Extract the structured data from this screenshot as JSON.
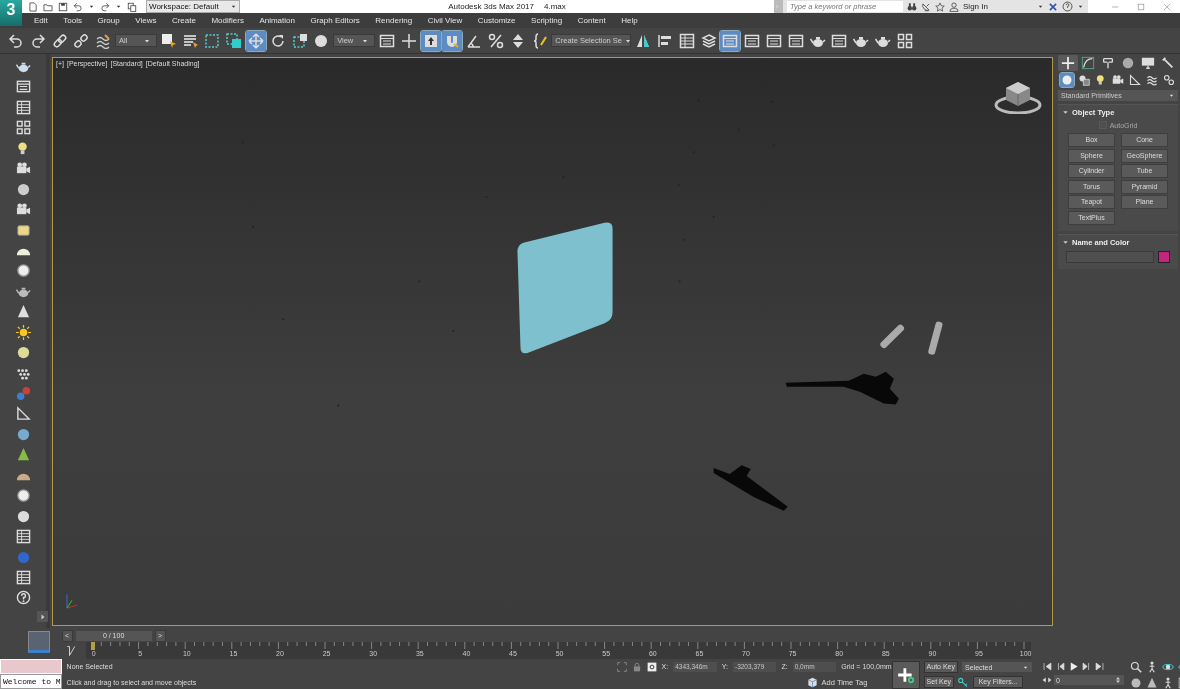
{
  "title_bar": {
    "logo": "3",
    "workspace": "Workspace: Default",
    "app_title": "Autodesk 3ds Max 2017",
    "file_name": "4.max",
    "search": {
      "placeholder": "Type a keyword or phrase"
    },
    "sign_in": "Sign In"
  },
  "menu": [
    "Edit",
    "Tools",
    "Group",
    "Views",
    "Create",
    "Modifiers",
    "Animation",
    "Graph Editors",
    "Rendering",
    "Civil View",
    "Customize",
    "Scripting",
    "Content",
    "Help"
  ],
  "main_toolbar": [
    {
      "kind": "tool",
      "selected": false
    },
    {
      "kind": "tool",
      "selected": false
    },
    {
      "kind": "tool",
      "selected": false
    },
    {
      "kind": "tool",
      "selected": false
    },
    {
      "kind": "tool",
      "selected": false
    },
    {
      "kind": "dropdown",
      "value": "All"
    },
    {
      "kind": "tool",
      "selected": false
    },
    {
      "kind": "tool",
      "selected": false
    },
    {
      "kind": "tool",
      "selected": false
    },
    {
      "kind": "tool",
      "selected": false
    },
    {
      "kind": "tool",
      "selected": true
    },
    {
      "kind": "tool",
      "selected": false
    },
    {
      "kind": "tool",
      "selected": false
    },
    {
      "kind": "tool",
      "selected": false
    },
    {
      "kind": "dropdown",
      "value": "View"
    },
    {
      "kind": "tool",
      "selected": false
    },
    {
      "kind": "tool",
      "selected": false
    },
    {
      "kind": "tool",
      "selected": true
    },
    {
      "kind": "tool",
      "selected": true
    },
    {
      "kind": "tool",
      "selected": false
    },
    {
      "kind": "tool",
      "selected": false
    },
    {
      "kind": "tool",
      "selected": false
    },
    {
      "kind": "tool",
      "selected": false
    },
    {
      "kind": "dropdown",
      "value": "Create Selection Se"
    },
    {
      "kind": "tool",
      "selected": false
    },
    {
      "kind": "tool",
      "selected": false
    },
    {
      "kind": "tool",
      "selected": false
    },
    {
      "kind": "tool",
      "selected": false
    },
    {
      "kind": "tool",
      "selected": true
    },
    {
      "kind": "tool",
      "selected": false
    },
    {
      "kind": "tool",
      "selected": false
    },
    {
      "kind": "tool",
      "selected": false
    },
    {
      "kind": "tool",
      "selected": false
    },
    {
      "kind": "tool",
      "selected": false
    },
    {
      "kind": "tool",
      "selected": false
    },
    {
      "kind": "tool",
      "selected": false
    },
    {
      "kind": "tool",
      "selected": false
    }
  ],
  "viewport": {
    "labels": [
      "[+]",
      "[Perspective]",
      "[Standard]",
      "[Default Shading]"
    ]
  },
  "command_panel": {
    "tabs": [
      {
        "selected": true
      },
      {
        "selected": false
      },
      {
        "selected": false
      },
      {
        "selected": false
      },
      {
        "selected": false
      },
      {
        "selected": false
      }
    ],
    "categories": [
      {
        "selected": true
      },
      {
        "selected": false
      },
      {
        "selected": false
      },
      {
        "selected": false
      },
      {
        "selected": false
      },
      {
        "selected": false
      },
      {
        "selected": false
      }
    ],
    "type_dropdown": "Standard Primitives",
    "rollouts": [
      {
        "title": "Object Type",
        "expanded": true,
        "autogrid": {
          "label": "AutoGrid",
          "checked": false,
          "disabled": true
        },
        "buttons": [
          "Box",
          "Cone",
          "Sphere",
          "GeoSphere",
          "Cylinder",
          "Tube",
          "Torus",
          "Pyramid",
          "Teapot",
          "Plane",
          "TextPlus"
        ]
      },
      {
        "title": "Name and Color",
        "expanded": true,
        "color": "#c4247f"
      }
    ]
  },
  "timeline": {
    "prev": "<",
    "range": "0 / 100",
    "next": ">",
    "level": 0,
    "frames": [
      "0",
      "5",
      "10",
      "15",
      "20",
      "25",
      "30",
      "35",
      "40",
      "45",
      "50",
      "55",
      "60",
      "65",
      "70",
      "75",
      "80",
      "85",
      "90",
      "95",
      "100"
    ]
  },
  "status": {
    "selection": "None Selected",
    "prompt": "Click and drag to select and move objects",
    "listener": "Welcome to M"
  },
  "coordinates": {
    "fields": [
      {
        "label": "X:",
        "value": "4343,346m"
      },
      {
        "label": "Y:",
        "value": "-3203,379"
      },
      {
        "label": "Z:",
        "value": "0,0mm"
      }
    ],
    "grid": "Grid = 100,0mm",
    "time_tag": "Add Time Tag"
  },
  "animation": {
    "auto_key": "Auto Key",
    "key_mode": "Selected",
    "set_key": "Set Key",
    "key_filters": "Key Filters...",
    "frame": "0"
  }
}
